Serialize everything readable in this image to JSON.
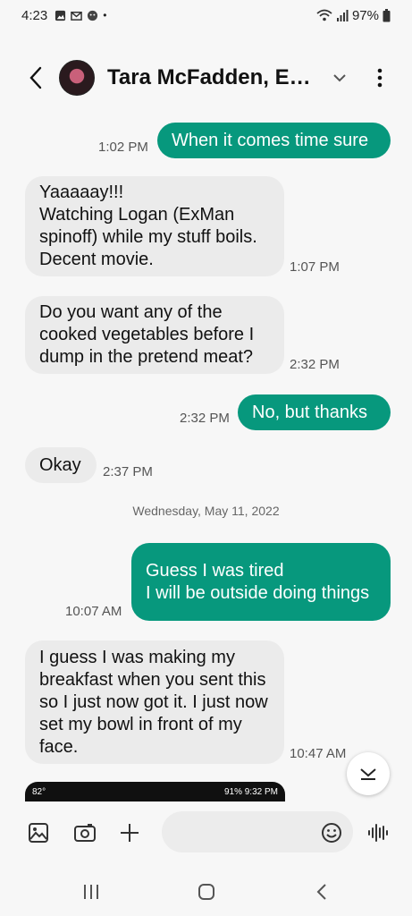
{
  "status_bar": {
    "time": "4:23",
    "dot": "•",
    "battery": "97%"
  },
  "header": {
    "contact_name": "Tara McFadden, Ex-..."
  },
  "messages": [
    {
      "dir": "out",
      "text": "When it comes time sure",
      "time": "1:02 PM"
    },
    {
      "dir": "in",
      "text": "Yaaaaay!!!\nWatching Logan (ExMan spinoff) while my stuff boils. Decent movie.",
      "time": "1:07 PM"
    },
    {
      "dir": "in",
      "text": "Do you want any of the cooked vegetables before I dump in the pretend meat?",
      "time": "2:32 PM"
    },
    {
      "dir": "out",
      "text": "No, but thanks",
      "time": "2:32 PM"
    },
    {
      "dir": "in",
      "text": "Okay",
      "time": "2:37 PM"
    },
    {
      "dir": "out",
      "text": "Guess I was tired\nI will be outside doing things",
      "time": "10:07 AM"
    },
    {
      "dir": "in",
      "text": "I guess I was making my breakfast when you sent this so I just now got it. I just now set my bowl in front of my face.",
      "time": "10:47 AM"
    }
  ],
  "date_divider": "Wednesday, May 11, 2022",
  "image_preview": {
    "left_status": "82°",
    "right_status": "91% 9:32 PM"
  },
  "colors": {
    "outgoing": "#07987d",
    "incoming": "#ebebeb",
    "background": "#f7f7f7"
  }
}
